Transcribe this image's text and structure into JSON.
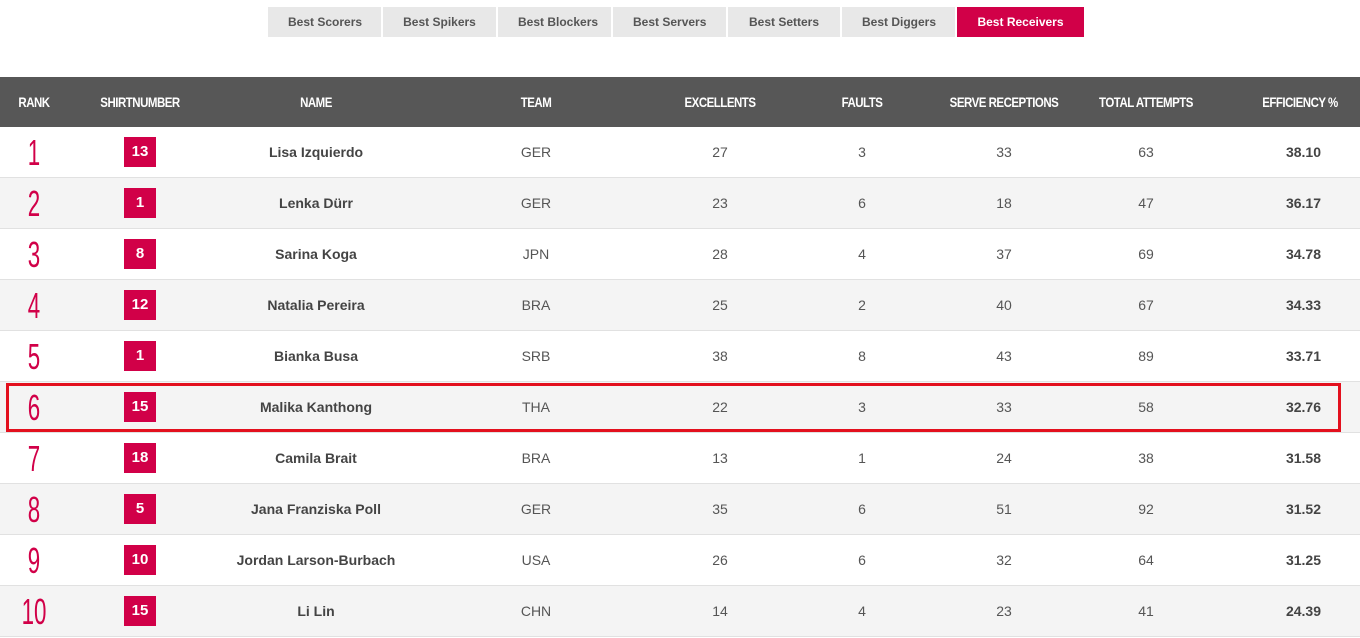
{
  "tabs": [
    {
      "label": "Best Scorers",
      "active": false
    },
    {
      "label": "Best Spikers",
      "active": false
    },
    {
      "label": "Best Blockers",
      "active": false
    },
    {
      "label": "Best Servers",
      "active": false
    },
    {
      "label": "Best Setters",
      "active": false
    },
    {
      "label": "Best Diggers",
      "active": false
    },
    {
      "label": "Best Receivers",
      "active": true
    }
  ],
  "table": {
    "headers": {
      "rank": "RANK",
      "shirt": "SHIRTNUMBER",
      "name": "NAME",
      "team": "TEAM",
      "excellents": "EXCELLENTS",
      "faults": "FAULTS",
      "serve_receptions": "SERVE RECEPTIONS",
      "total_attempts": "TOTAL ATTEMPTS",
      "efficiency": "EFFICIENCY %"
    },
    "rows": [
      {
        "rank": "1",
        "shirt": "13",
        "name": "Lisa Izquierdo",
        "team": "GER",
        "excellents": "27",
        "faults": "3",
        "serve_receptions": "33",
        "total_attempts": "63",
        "efficiency": "38.10"
      },
      {
        "rank": "2",
        "shirt": "1",
        "name": "Lenka Dürr",
        "team": "GER",
        "excellents": "23",
        "faults": "6",
        "serve_receptions": "18",
        "total_attempts": "47",
        "efficiency": "36.17"
      },
      {
        "rank": "3",
        "shirt": "8",
        "name": "Sarina Koga",
        "team": "JPN",
        "excellents": "28",
        "faults": "4",
        "serve_receptions": "37",
        "total_attempts": "69",
        "efficiency": "34.78"
      },
      {
        "rank": "4",
        "shirt": "12",
        "name": "Natalia Pereira",
        "team": "BRA",
        "excellents": "25",
        "faults": "2",
        "serve_receptions": "40",
        "total_attempts": "67",
        "efficiency": "34.33"
      },
      {
        "rank": "5",
        "shirt": "1",
        "name": "Bianka Busa",
        "team": "SRB",
        "excellents": "38",
        "faults": "8",
        "serve_receptions": "43",
        "total_attempts": "89",
        "efficiency": "33.71"
      },
      {
        "rank": "6",
        "shirt": "15",
        "name": "Malika Kanthong",
        "team": "THA",
        "excellents": "22",
        "faults": "3",
        "serve_receptions": "33",
        "total_attempts": "58",
        "efficiency": "32.76"
      },
      {
        "rank": "7",
        "shirt": "18",
        "name": "Camila Brait",
        "team": "BRA",
        "excellents": "13",
        "faults": "1",
        "serve_receptions": "24",
        "total_attempts": "38",
        "efficiency": "31.58"
      },
      {
        "rank": "8",
        "shirt": "5",
        "name": "Jana Franziska Poll",
        "team": "GER",
        "excellents": "35",
        "faults": "6",
        "serve_receptions": "51",
        "total_attempts": "92",
        "efficiency": "31.52"
      },
      {
        "rank": "9",
        "shirt": "10",
        "name": "Jordan Larson-Burbach",
        "team": "USA",
        "excellents": "26",
        "faults": "6",
        "serve_receptions": "32",
        "total_attempts": "64",
        "efficiency": "31.25"
      },
      {
        "rank": "10",
        "shirt": "15",
        "name": "Li Lin",
        "team": "CHN",
        "excellents": "14",
        "faults": "4",
        "serve_receptions": "23",
        "total_attempts": "41",
        "efficiency": "24.39"
      }
    ]
  },
  "colors": {
    "accent": "#d10048",
    "header_bg": "#575757",
    "tab_bg": "#e8e8e8",
    "highlight_border": "#e3101e",
    "row_alt": "#f4f4f4"
  }
}
